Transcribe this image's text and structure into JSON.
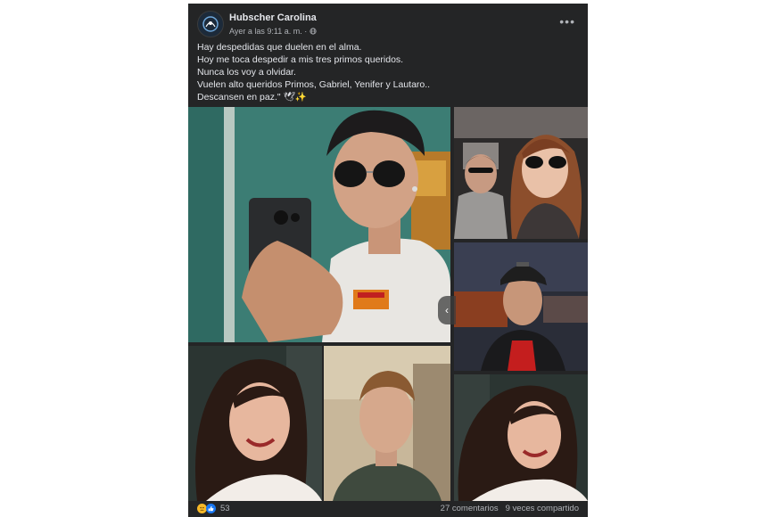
{
  "post": {
    "author": "Hubscher Carolina",
    "timestamp": "Ayer a las 9:11 a. m. ·",
    "audience_icon": "globe-icon",
    "menu_icon": "more-options-icon",
    "caption_lines": [
      "Hay despedidas que duelen en el alma.",
      "Hoy me toca despedir a mis tres primos queridos.",
      "Nunca los voy a olvidar.",
      "Vuelen alto  queridos Primos,  Gabriel, Yenifer y Lautaro..",
      "Descansen en paz.\" 🕊✨"
    ]
  },
  "footer": {
    "reaction_icons": [
      "sad-reaction-icon",
      "like-reaction-icon"
    ],
    "reaction_count": "53",
    "comments": "27 comentarios",
    "shares": "9 veces compartido"
  },
  "colors": {
    "post_bg": "#242526",
    "text_primary": "#e4e6eb",
    "text_secondary": "#b0b3b8"
  }
}
